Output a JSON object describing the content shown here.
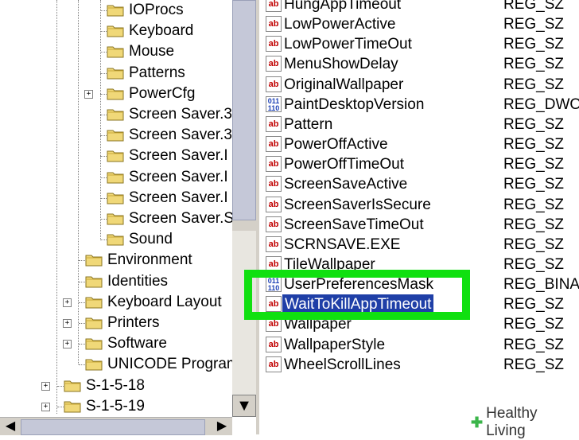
{
  "tree": {
    "items": [
      {
        "label": "IOProcs",
        "expander": ""
      },
      {
        "label": "Keyboard",
        "expander": ""
      },
      {
        "label": "Mouse",
        "expander": ""
      },
      {
        "label": "Patterns",
        "expander": ""
      },
      {
        "label": "PowerCfg",
        "expander": "+"
      },
      {
        "label": "Screen Saver.3",
        "expander": ""
      },
      {
        "label": "Screen Saver.3",
        "expander": ""
      },
      {
        "label": "Screen Saver.I",
        "expander": ""
      },
      {
        "label": "Screen Saver.I",
        "expander": ""
      },
      {
        "label": "Screen Saver.I",
        "expander": ""
      },
      {
        "label": "Screen Saver.S",
        "expander": ""
      },
      {
        "label": "Sound",
        "expander": ""
      },
      {
        "label": "Environment",
        "expander": ""
      },
      {
        "label": "Identities",
        "expander": ""
      },
      {
        "label": "Keyboard Layout",
        "expander": "+"
      },
      {
        "label": "Printers",
        "expander": "+"
      },
      {
        "label": "Software",
        "expander": "+"
      },
      {
        "label": "UNICODE Program",
        "expander": ""
      },
      {
        "label": "S-1-5-18",
        "expander": "+"
      },
      {
        "label": "S-1-5-19",
        "expander": "+"
      }
    ]
  },
  "values": {
    "rows": [
      {
        "name": "HungAppTimeout",
        "type": "REG_SZ",
        "icon": "string-value-icon",
        "icon_text": "ab"
      },
      {
        "name": "LowPowerActive",
        "type": "REG_SZ",
        "icon": "string-value-icon",
        "icon_text": "ab"
      },
      {
        "name": "LowPowerTimeOut",
        "type": "REG_SZ",
        "icon": "string-value-icon",
        "icon_text": "ab"
      },
      {
        "name": "MenuShowDelay",
        "type": "REG_SZ",
        "icon": "string-value-icon",
        "icon_text": "ab"
      },
      {
        "name": "OriginalWallpaper",
        "type": "REG_SZ",
        "icon": "string-value-icon",
        "icon_text": "ab"
      },
      {
        "name": "PaintDesktopVersion",
        "type": "REG_DWO",
        "icon": "binary-value-icon",
        "icon_text": "011 110"
      },
      {
        "name": "Pattern",
        "type": "REG_SZ",
        "icon": "string-value-icon",
        "icon_text": "ab"
      },
      {
        "name": "PowerOffActive",
        "type": "REG_SZ",
        "icon": "string-value-icon",
        "icon_text": "ab"
      },
      {
        "name": "PowerOffTimeOut",
        "type": "REG_SZ",
        "icon": "string-value-icon",
        "icon_text": "ab"
      },
      {
        "name": "ScreenSaveActive",
        "type": "REG_SZ",
        "icon": "string-value-icon",
        "icon_text": "ab"
      },
      {
        "name": "ScreenSaverIsSecure",
        "type": "REG_SZ",
        "icon": "string-value-icon",
        "icon_text": "ab"
      },
      {
        "name": "ScreenSaveTimeOut",
        "type": "REG_SZ",
        "icon": "string-value-icon",
        "icon_text": "ab"
      },
      {
        "name": "SCRNSAVE.EXE",
        "type": "REG_SZ",
        "icon": "string-value-icon",
        "icon_text": "ab"
      },
      {
        "name": "TileWallpaper",
        "type": "REG_SZ",
        "icon": "string-value-icon",
        "icon_text": "ab"
      },
      {
        "name": "UserPreferencesMask",
        "type": "REG_BINA",
        "icon": "binary-value-icon",
        "icon_text": "011 110"
      },
      {
        "name": "WaitToKillAppTimeout",
        "type": "REG_SZ",
        "icon": "string-value-icon",
        "icon_text": "ab",
        "selected": true
      },
      {
        "name": "Wallpaper",
        "type": "REG_SZ",
        "icon": "string-value-icon",
        "icon_text": "ab"
      },
      {
        "name": "WallpaperStyle",
        "type": "REG_SZ",
        "icon": "string-value-icon",
        "icon_text": "ab"
      },
      {
        "name": "WheelScrollLines",
        "type": "REG_SZ",
        "icon": "string-value-icon",
        "icon_text": "ab"
      }
    ]
  },
  "scroll": {
    "up_arrow": "▲",
    "down_arrow": "▼",
    "left_arrow": "◀",
    "right_arrow": "▶"
  },
  "watermark": {
    "brand": "Healthy Living",
    "mark": "✚"
  },
  "colors": {
    "selection": "#1f3fa7",
    "highlight": "#10e010"
  }
}
